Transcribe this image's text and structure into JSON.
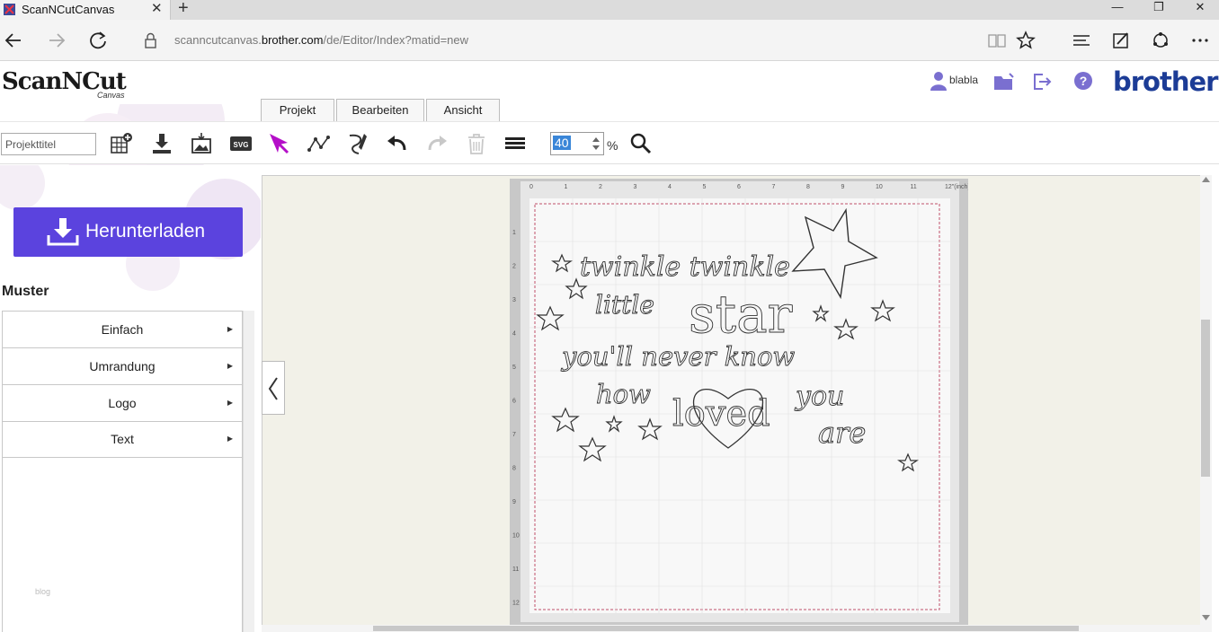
{
  "browser": {
    "tab_title": "ScanNCutCanvas",
    "url_prefix": "scanncutcanvas.",
    "url_domain": "brother.com",
    "url_path": "/de/Editor/Index?matid=new"
  },
  "header": {
    "logo_text": "ScanNCut",
    "logo_sub": "Canvas",
    "username": "blabla",
    "brand": "brother",
    "menu_tabs": [
      "Projekt",
      "Bearbeiten",
      "Ansicht"
    ]
  },
  "toolbar": {
    "project_title_placeholder": "Projekttitel",
    "zoom_value": "40",
    "zoom_unit": "%"
  },
  "sidebar": {
    "download_label": "Herunterladen",
    "section_title": "Muster",
    "items": [
      {
        "label": "Einfach"
      },
      {
        "label": "Umrandung"
      },
      {
        "label": "Logo"
      },
      {
        "label": "Text"
      }
    ],
    "watermark": "blog"
  },
  "canvas": {
    "lines": [
      "twinkle twinkle",
      "little",
      "star",
      "you'll never know",
      "how",
      "loved",
      "you",
      "are"
    ],
    "ruler_top": [
      "0",
      "1",
      "2",
      "3",
      "4",
      "5",
      "6",
      "7",
      "8",
      "9",
      "10",
      "11",
      "12\"(inch)"
    ],
    "ruler_left": [
      "1",
      "2",
      "3",
      "4",
      "5",
      "6",
      "7",
      "8",
      "9",
      "10",
      "11",
      "12"
    ]
  },
  "colors": {
    "accent_purple": "#5b43de",
    "brand_blue": "#1c3c96",
    "select_arrow": "#b40fc8",
    "mat_border": "#c8c8c8",
    "cut_line": "#c0506a"
  }
}
